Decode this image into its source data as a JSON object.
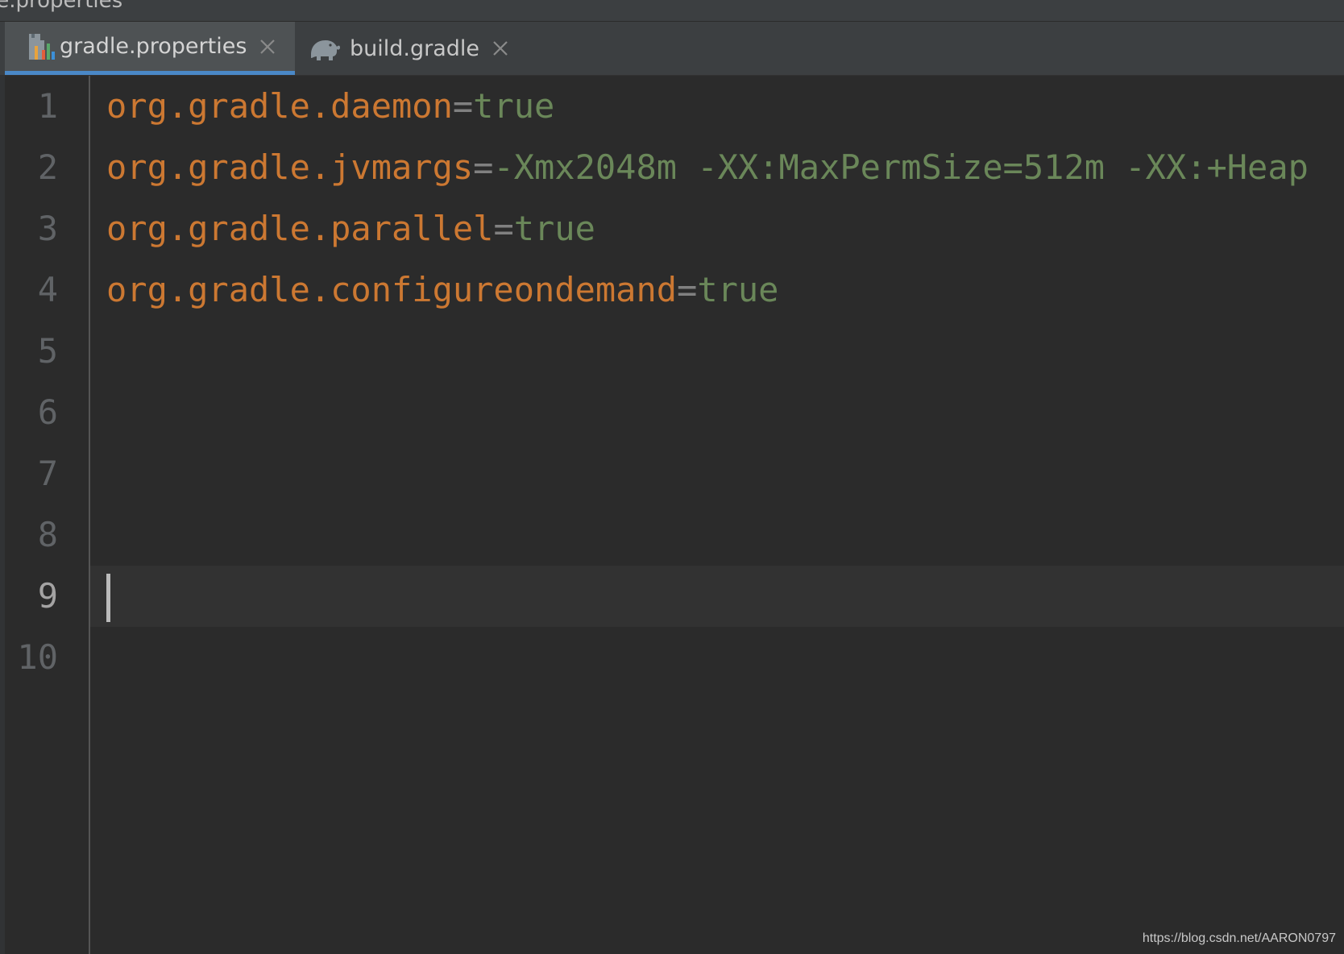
{
  "window": {
    "title": "le.properties"
  },
  "tabs": [
    {
      "label": "gradle.properties",
      "icon": "properties-file-icon",
      "active": true
    },
    {
      "label": "build.gradle",
      "icon": "gradle-elephant-icon",
      "active": false
    }
  ],
  "editor": {
    "line_numbers": [
      "1",
      "2",
      "3",
      "4",
      "5",
      "6",
      "7",
      "8",
      "9",
      "10"
    ],
    "current_line": "9",
    "lines": [
      {
        "key": "org.gradle.daemon",
        "eq": "=",
        "value": "true"
      },
      {
        "key": "org.gradle.jvmargs",
        "eq": "=",
        "value": "-Xmx2048m -XX:MaxPermSize=512m -XX:+Heap"
      },
      {
        "key": "org.gradle.parallel",
        "eq": "=",
        "value": "true"
      },
      {
        "key": "org.gradle.configureondemand",
        "eq": "=",
        "value": "true"
      }
    ]
  },
  "watermark": "https://blog.csdn.net/AARON0797",
  "colors": {
    "background": "#2b2b2b",
    "key": "#cc7832",
    "value": "#6a8759",
    "active_tab_underline": "#4a88c7"
  }
}
